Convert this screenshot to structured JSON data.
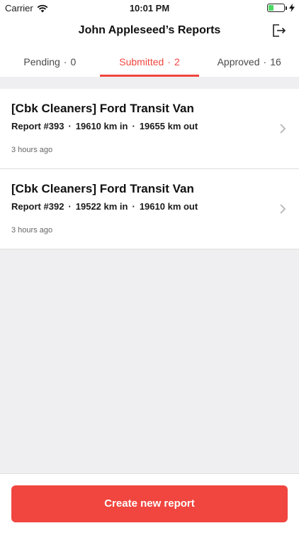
{
  "status_bar": {
    "carrier": "Carrier",
    "time": "10:01 PM",
    "battery_level": 0.35,
    "battery_color": "#4cd964"
  },
  "header": {
    "title": "John Appleseed’s Reports",
    "logout_icon": "logout-icon"
  },
  "tabs": [
    {
      "label": "Pending",
      "count": "0",
      "active": false
    },
    {
      "label": "Submitted",
      "count": "2",
      "active": true
    },
    {
      "label": "Approved",
      "count": "16",
      "active": false
    }
  ],
  "tab_separator": "·",
  "reports": [
    {
      "title": "[Cbk Cleaners] Ford Transit Van",
      "report_no": "Report #393",
      "km_in": "19610 km in",
      "km_out": "19655 km out",
      "time_ago": "3 hours ago"
    },
    {
      "title": "[Cbk Cleaners] Ford Transit Van",
      "report_no": "Report #392",
      "km_in": "19522 km in",
      "km_out": "19610 km out",
      "time_ago": "3 hours ago"
    }
  ],
  "footer": {
    "create_label": "Create new report"
  },
  "colors": {
    "accent": "#f0463f",
    "background": "#efeff1"
  }
}
